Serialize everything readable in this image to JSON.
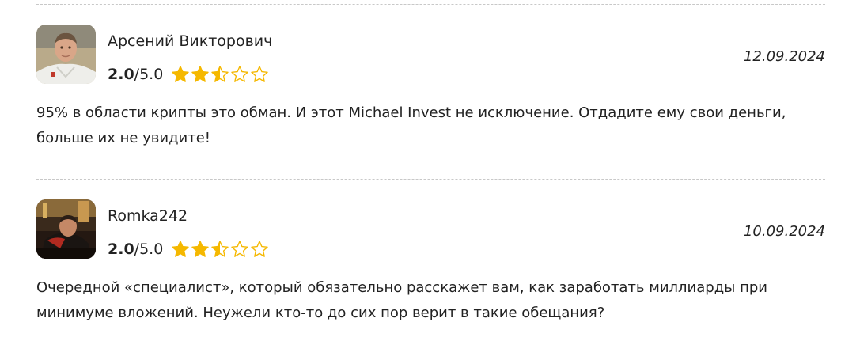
{
  "reviews": [
    {
      "author": "Арсений Викторович",
      "score": "2.0",
      "scale": "/5.0",
      "rating": 2.5,
      "max_rating": 5,
      "date": "12.09.2024",
      "text": "95% в области крипты это обман. И этот Michael Invest не исключение. Отдадите ему свои деньги, больше их не увидите!"
    },
    {
      "author": "Romka242",
      "score": "2.0",
      "scale": "/5.0",
      "rating": 2.5,
      "max_rating": 5,
      "date": "10.09.2024",
      "text": "Очередной «специалист», который обязательно расскажет вам, как заработать миллиарды при минимуме вложений. Неужели кто-то до сих пор верит в такие обещания?"
    }
  ],
  "colors": {
    "star": "#f5b800",
    "divider": "#c8c8c8",
    "text": "#222222"
  },
  "icons": {
    "star_full": "star-full-icon",
    "star_half": "star-half-icon",
    "star_empty": "star-empty-icon"
  }
}
